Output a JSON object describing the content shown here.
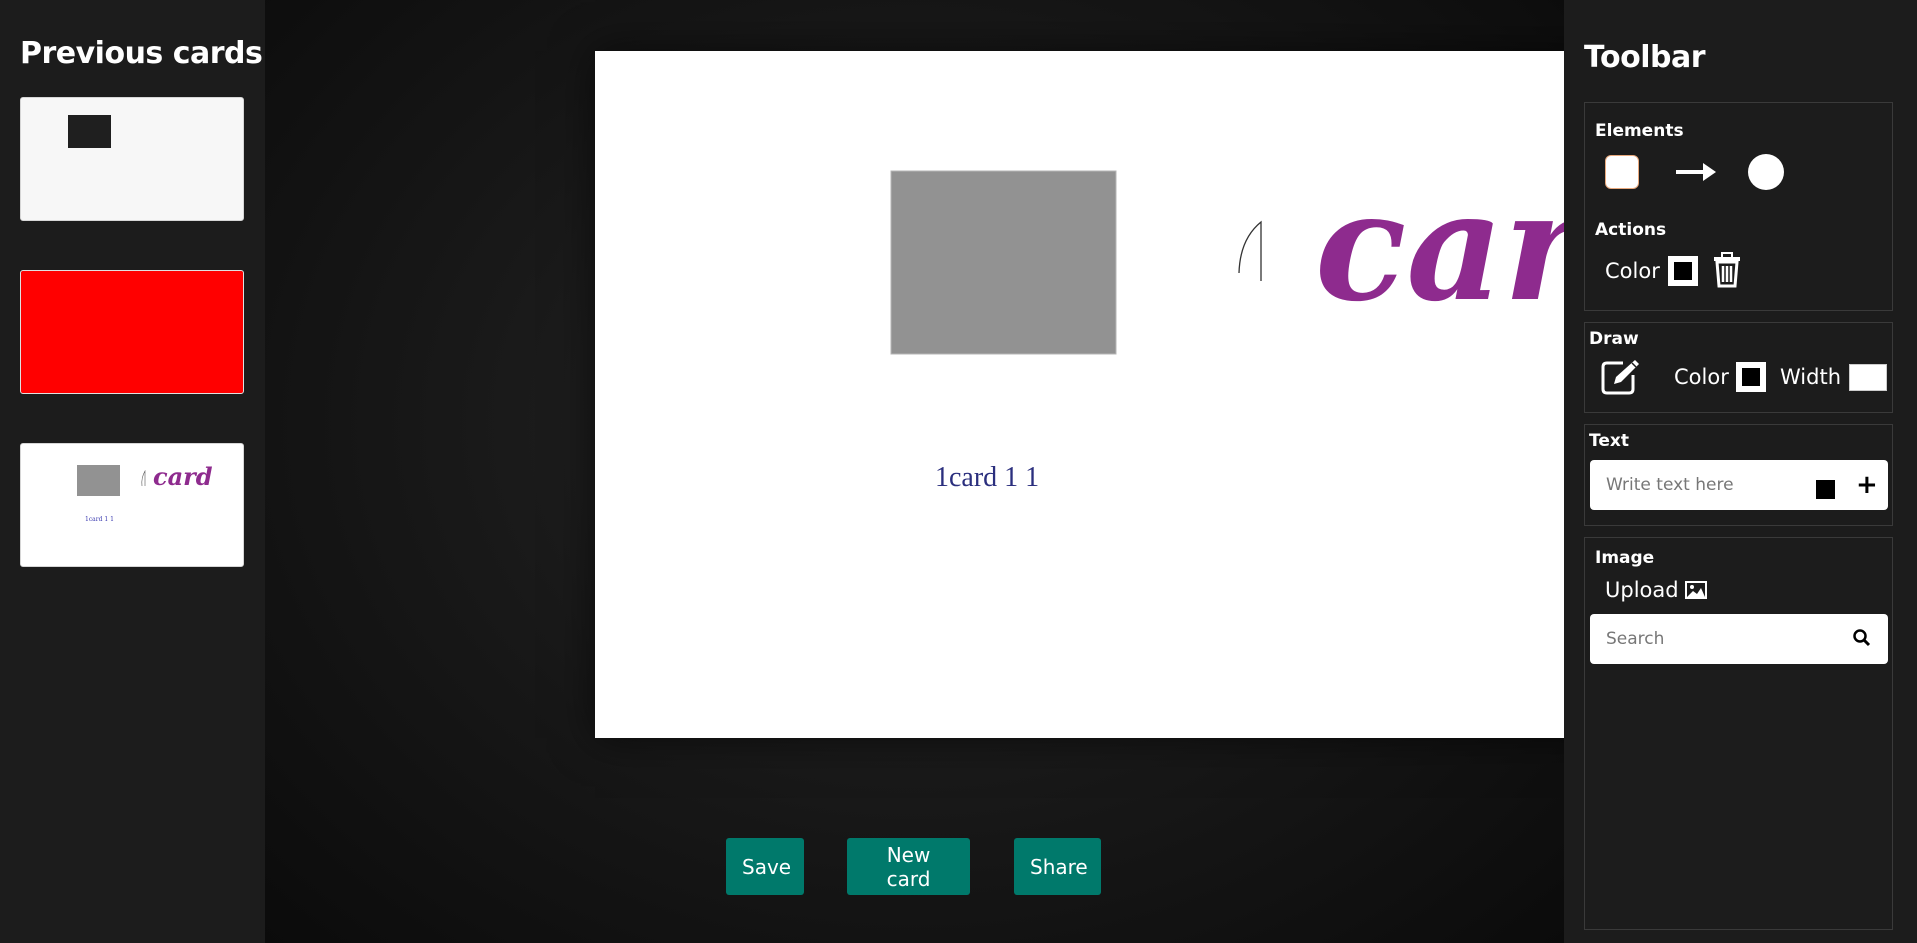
{
  "left_panel": {
    "title": "Previous cards"
  },
  "thumbnails": {
    "card3_text": "1card 1 1",
    "card3_drawn_word": "card"
  },
  "canvas": {
    "text_element": "1card 1 1",
    "text_color": "#2b2f7e",
    "drawn_word": "card",
    "drawn_color": "#8e2b8e",
    "rect_color": "#929292"
  },
  "buttons": {
    "save": "Save",
    "new_card": "New card",
    "share": "Share"
  },
  "toolbar": {
    "title": "Toolbar",
    "elements_heading": "Elements",
    "actions_heading": "Actions",
    "actions_color_label": "Color",
    "draw_heading": "Draw",
    "draw_color_label": "Color",
    "draw_width_label": "Width",
    "text_heading": "Text",
    "text_placeholder": "Write text here",
    "image_heading": "Image",
    "upload_label": "Upload",
    "search_placeholder": "Search"
  },
  "icons": [
    "square-icon",
    "arrow-icon",
    "circle-icon",
    "trash-icon",
    "pencil-edit-icon",
    "plus-icon",
    "image-icon",
    "search-icon"
  ],
  "colors": {
    "accent": "#00796b",
    "panel": "#1c1c1c",
    "red_card": "#ff0000"
  }
}
